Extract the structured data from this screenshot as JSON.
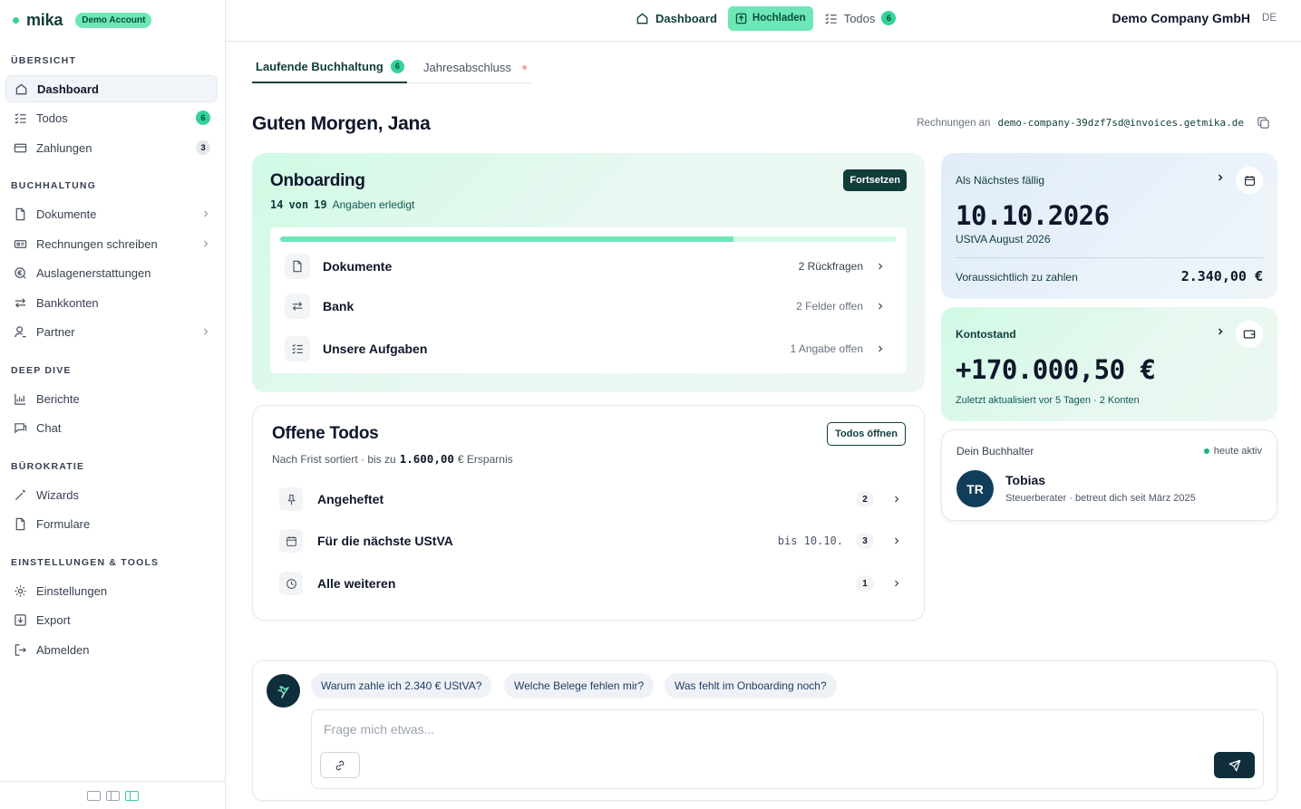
{
  "brand": {
    "name": "mika",
    "badge": "Demo Account"
  },
  "sidebar": {
    "sections": [
      {
        "title": "ÜBERSICHT"
      },
      {
        "title": "BUCHHALTUNG"
      },
      {
        "title": "DEEP DIVE"
      },
      {
        "title": "BÜROKRATIE"
      },
      {
        "title": "EINSTELLUNGEN & TOOLS"
      }
    ],
    "items": [
      {
        "label": "Dashboard",
        "icon": "home-icon"
      },
      {
        "label": "Todos",
        "icon": "checklist-icon",
        "badge": "6"
      },
      {
        "label": "Zahlungen",
        "icon": "card-icon",
        "badge": "3"
      },
      {
        "label": "Dokumente",
        "icon": "document-icon"
      },
      {
        "label": "Rechnungen schreiben",
        "icon": "invoice-icon"
      },
      {
        "label": "Auslagenerstattungen",
        "icon": "expense-icon"
      },
      {
        "label": "Bankkonten",
        "icon": "transfer-icon"
      },
      {
        "label": "Partner",
        "icon": "person-icon"
      },
      {
        "label": "Berichte",
        "icon": "chart-icon"
      },
      {
        "label": "Chat",
        "icon": "chat-icon"
      },
      {
        "label": "Wizards",
        "icon": "wand-icon"
      },
      {
        "label": "Formulare",
        "icon": "form-icon"
      },
      {
        "label": "Einstellungen",
        "icon": "gear-icon"
      },
      {
        "label": "Export",
        "icon": "export-icon"
      },
      {
        "label": "Abmelden",
        "icon": "logout-icon"
      }
    ]
  },
  "topbar": {
    "dashboard": "Dashboard",
    "upload": "Hochladen",
    "todos": "Todos",
    "todos_badge": "6",
    "company": "Demo Company GmbH",
    "lang": "DE"
  },
  "tabs": {
    "current": "Laufende Buchhaltung",
    "current_badge": "6",
    "other": "Jahresabschluss"
  },
  "greeting": "Guten Morgen, Jana",
  "invoice": {
    "prefix": "Rechnungen an",
    "email": "demo-company-39dzf7sd@invoices.getmika.de"
  },
  "onboarding": {
    "title": "Onboarding",
    "done": "14",
    "of": "von",
    "total": "19",
    "suffix": "Angaben erledigt",
    "progress_fraction": 0.736,
    "continue": "Fortsetzen",
    "rows": [
      {
        "label": "Dokumente",
        "status": "2 Rückfragen",
        "icon": "document-icon"
      },
      {
        "label": "Bank",
        "status": "2 Felder offen",
        "icon": "transfer-icon"
      },
      {
        "label": "Unsere Aufgaben",
        "status": "1 Angabe offen",
        "icon": "checklist-icon"
      }
    ]
  },
  "todos": {
    "title": "Offene Todos",
    "sub_prefix": "Nach Frist sortiert · bis zu",
    "savings": "1.600,00",
    "sub_suffix": "€ Ersparnis",
    "open": "Todos öffnen",
    "rows": [
      {
        "label": "Angeheftet",
        "due": "",
        "count": "2",
        "icon": "pin-icon"
      },
      {
        "label": "Für die nächste UStVA",
        "due": "bis 10.10.",
        "count": "3",
        "icon": "calendar-icon"
      },
      {
        "label": "Alle weiteren",
        "due": "",
        "count": "1",
        "icon": "clock-icon"
      }
    ]
  },
  "next_due": {
    "label": "Als Nächstes fällig",
    "date": "10.10.2026",
    "sub": "UStVA August 2026",
    "foot_label": "Voraussichtlich zu zahlen",
    "amount": "2.340,00 €"
  },
  "balance": {
    "label": "Kontostand",
    "amount": "+170.000,50 €",
    "sub": "Zuletzt aktualisiert vor 5 Tagen · 2 Konten"
  },
  "accountant": {
    "label": "Dein Buchhalter",
    "status": "heute aktiv",
    "initials": "TR",
    "name": "Tobias",
    "role": "Steuerberater · betreut dich seit März 2025"
  },
  "chat": {
    "suggestions": [
      "Warum zahle ich 2.340 € UStVA?",
      "Welche Belege fehlen mir?",
      "Was fehlt im Onboarding noch?"
    ],
    "placeholder": "Frage mich etwas..."
  },
  "colors": {
    "accent": "#6ee7b7",
    "accent_strong": "#34d399",
    "brand_dark": "#0f3d3a"
  }
}
